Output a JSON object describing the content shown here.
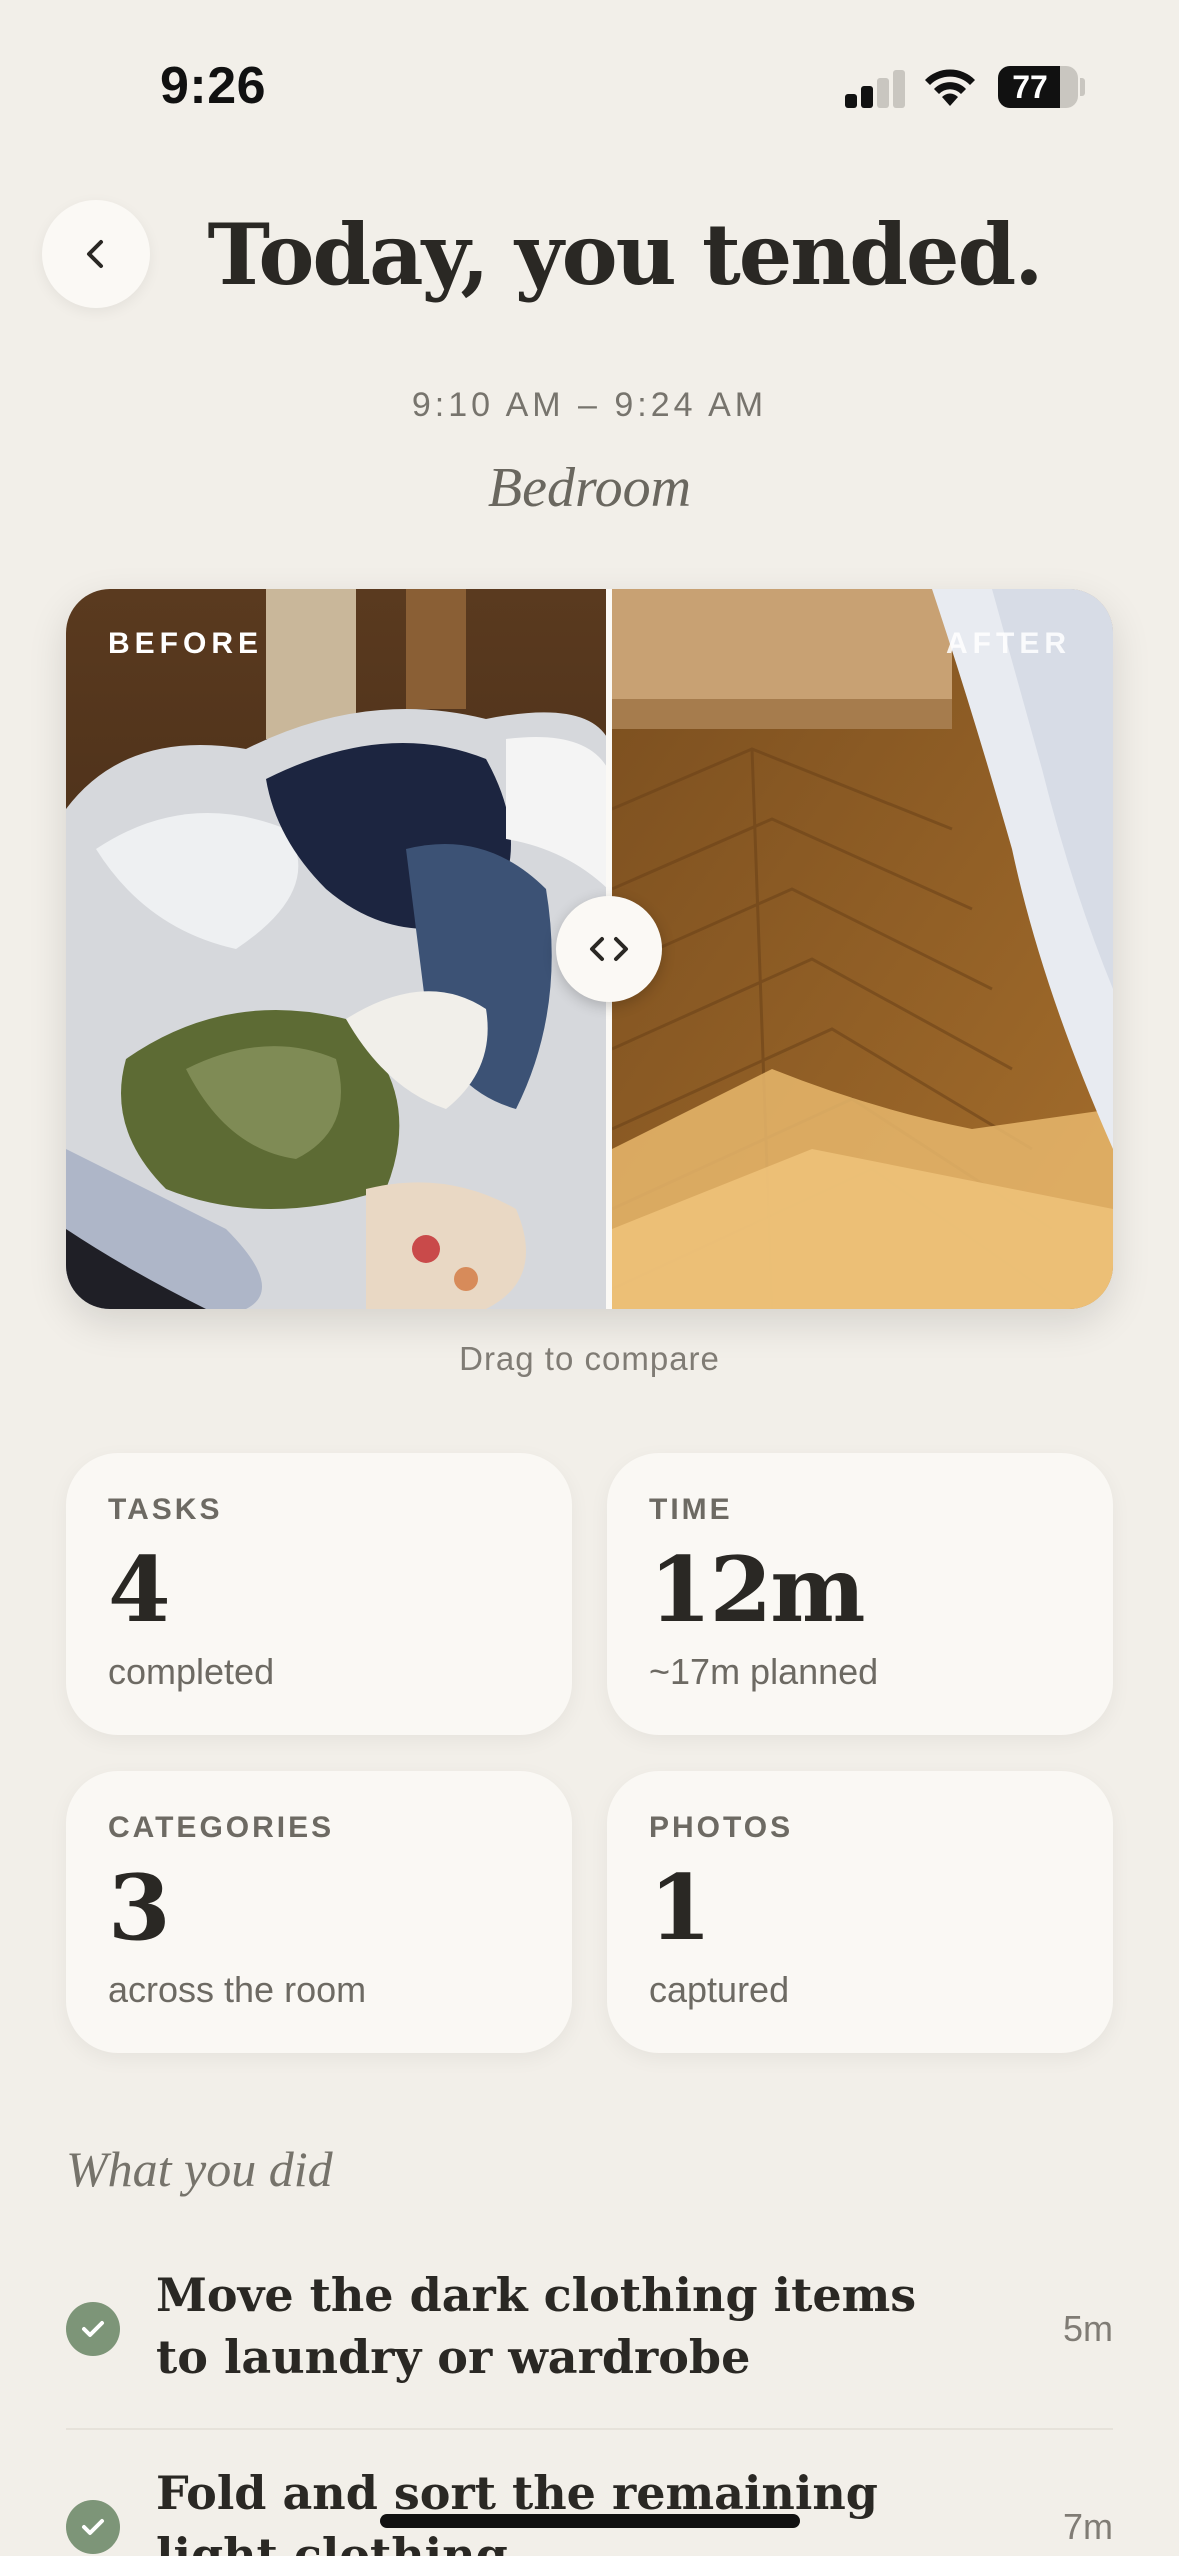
{
  "status_bar": {
    "time": "9:26",
    "battery": "77"
  },
  "header": {
    "title": "Today, you tended.",
    "time_range": "9:10 AM – 9:24 AM",
    "room": "Bedroom"
  },
  "compare": {
    "before_label": "BEFORE",
    "after_label": "AFTER",
    "hint": "Drag to compare",
    "slider_position": 0.52
  },
  "stats": [
    {
      "label": "TASKS",
      "value": "4",
      "sub": "completed"
    },
    {
      "label": "TIME",
      "value": "12m",
      "sub": "~17m planned"
    },
    {
      "label": "CATEGORIES",
      "value": "3",
      "sub": "across the room"
    },
    {
      "label": "PHOTOS",
      "value": "1",
      "sub": "captured"
    }
  ],
  "tasks_section": {
    "title": "What you did",
    "items": [
      {
        "text": "Move the dark clothing items to laundry or wardrobe",
        "duration": "5m"
      },
      {
        "text": "Fold and sort the remaining light clothing",
        "duration": "7m"
      }
    ]
  },
  "colors": {
    "background": "#f2efe9",
    "card": "#faf8f4",
    "check": "#7d9578"
  }
}
